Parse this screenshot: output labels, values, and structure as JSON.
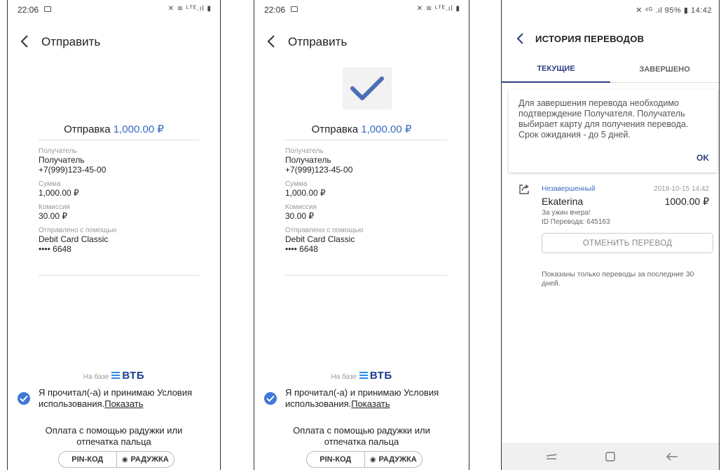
{
  "screen1": {
    "status": {
      "time": "22:06",
      "icons": "✕ ≋ ᴸᵀᴱ.ıl ▮"
    },
    "header": {
      "title": "Отправить"
    },
    "summary": {
      "prefix": "Отправка ",
      "amount": "1,000.00 ₽"
    },
    "details": [
      {
        "label": "Получатель",
        "lines": [
          "Получатель",
          "+7(999)123-45-00"
        ]
      },
      {
        "label": "Сумма",
        "lines": [
          "1,000.00 ₽"
        ]
      },
      {
        "label": "Комиссия",
        "lines": [
          "30.00 ₽"
        ]
      },
      {
        "label": "Отправлено с помощью",
        "lines": [
          "Debit Card Classic",
          "•••• 6648"
        ]
      }
    ],
    "powered": {
      "prefix": "На базе",
      "brand": "ВТБ"
    },
    "agree": {
      "text": "Я прочитал(-а) и принимаю Условия использования.",
      "link": "Показать"
    },
    "payline": "Оплата с помощью радужки или отпечатка пальца",
    "segment": {
      "pin": "PIN-КОД",
      "iris": "РАДУЖКА"
    }
  },
  "screen2": {
    "status": {
      "time": "22:06",
      "icons": "✕ ≋ ᴸᵀᴱ.ıl ▮"
    },
    "header": {
      "title": "Отправить"
    },
    "summary": {
      "prefix": "Отправка ",
      "amount": "1,000.00 ₽"
    },
    "details": [
      {
        "label": "Получатель",
        "lines": [
          "Получатель",
          "+7(999)123-45-00"
        ]
      },
      {
        "label": "Сумма",
        "lines": [
          "1,000.00 ₽"
        ]
      },
      {
        "label": "Комиссия",
        "lines": [
          "30.00 ₽"
        ]
      },
      {
        "label": "Отправлено с помощью",
        "lines": [
          "Debit Card Classic",
          "•••• 6648"
        ]
      }
    ],
    "powered": {
      "prefix": "На базе",
      "brand": "ВТБ"
    },
    "agree": {
      "text": "Я прочитал(-а) и принимаю Условия использования.",
      "link": "Показать"
    },
    "payline": "Оплата с помощью радужки или отпечатка пальца",
    "segment": {
      "pin": "PIN-КОД",
      "iris": "РАДУЖКА"
    }
  },
  "screen3": {
    "status": {
      "icons": "✕ ⁴ᴳ .ıl 95% ▮ 14:42"
    },
    "header": {
      "title": "ИСТОРИЯ ПЕРЕВОДОВ"
    },
    "tabs": [
      "ТЕКУЩИЕ",
      "ЗАВЕРШЕНО"
    ],
    "notice": {
      "text": "Для завершения перевода необходимо подтверждение Получателя. Получатель выбирает карту для получения перевода. Срок ожидания - до 5 дней.",
      "ok": "OK"
    },
    "transfer": {
      "status": "Незавершенный",
      "date": "2018-10-15 14:42",
      "name": "Ekaterina",
      "amount": "1000.00 ₽",
      "comment": "За ужин вчера!",
      "id": "ID Перевода: 645163",
      "cancel": "ОТМЕНИТЬ ПЕРЕВОД"
    },
    "hint": "Показаны только переводы за последние 30 дней."
  },
  "colors": {
    "accent": "#3a6ac2",
    "checkbox": "#3f78d8",
    "navy": "#2e3e82",
    "vtb": "#1b3f8f"
  }
}
